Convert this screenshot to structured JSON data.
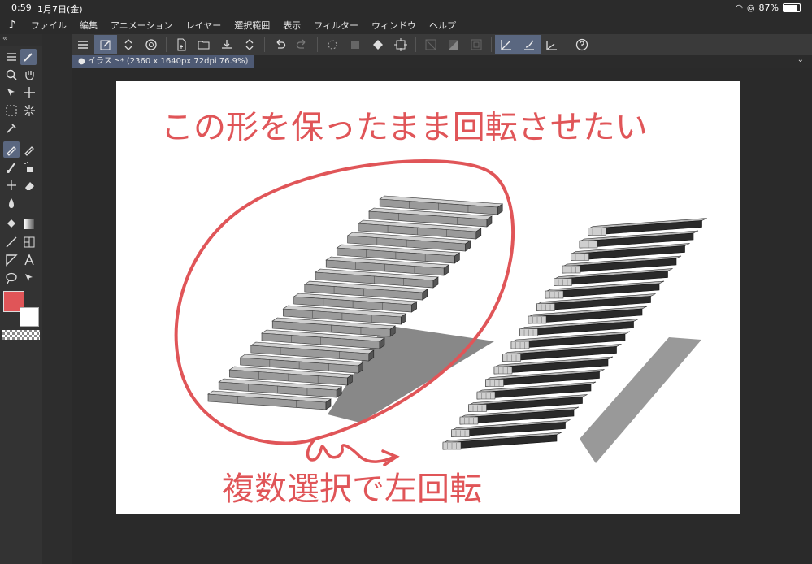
{
  "status": {
    "time": "0:59",
    "date": "1月7日(金)",
    "battery": "87%"
  },
  "menu": {
    "items": [
      "ファイル",
      "編集",
      "アニメーション",
      "レイヤー",
      "選択範囲",
      "表示",
      "フィルター",
      "ウィンドウ",
      "ヘルプ"
    ]
  },
  "document": {
    "tab_label": "イラスト* (2360 x 1640px 72dpi 76.9%)"
  },
  "colors": {
    "main": "#e05558",
    "sub": "#ffffff",
    "accent": "#5a6780"
  },
  "annotation": {
    "top_text": "この形を保ったまま回転させたい",
    "bottom_text": "複数選択で左回転",
    "color": "#e05558"
  }
}
